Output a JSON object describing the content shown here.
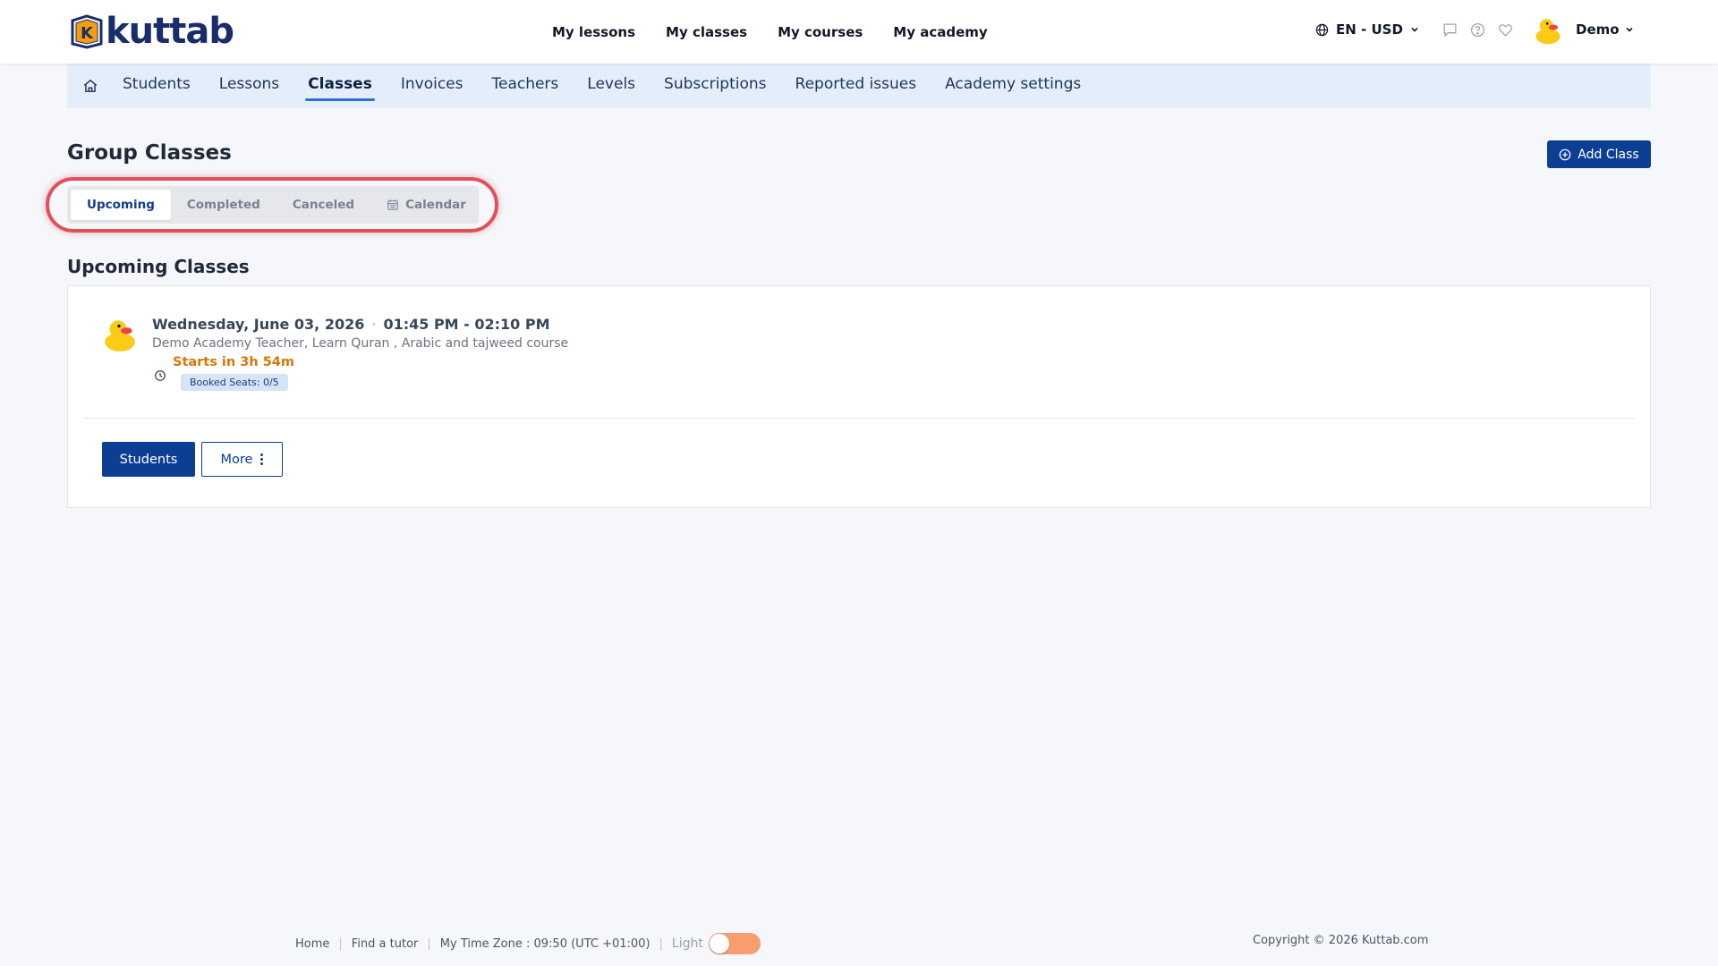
{
  "header": {
    "logo_text": "kuttab",
    "logo_letter": "K",
    "nav": [
      "My lessons",
      "My classes",
      "My courses",
      "My academy"
    ],
    "lang_label": "EN - USD",
    "user_name": "Demo"
  },
  "subnav": {
    "items": [
      "Students",
      "Lessons",
      "Classes",
      "Invoices",
      "Teachers",
      "Levels",
      "Subscriptions",
      "Reported issues",
      "Academy settings"
    ],
    "active": "Classes"
  },
  "page": {
    "title": "Group Classes",
    "add_button": "Add Class"
  },
  "tabs": {
    "upcoming": "Upcoming",
    "completed": "Completed",
    "canceled": "Canceled",
    "calendar": "Calendar",
    "active": "Upcoming"
  },
  "section": {
    "title": "Upcoming Classes"
  },
  "class_card": {
    "date": "Wednesday, June 03, 2026",
    "separator": "·",
    "time": "01:45 PM - 02:10 PM",
    "subtitle": "Demo Academy Teacher, Learn Quran , Arabic and tajweed course",
    "starts_in": "Starts in 3h 54m",
    "booked_seats": "Booked Seats: 0/5",
    "students_button": "Students",
    "more_button": "More"
  },
  "footer": {
    "home": "Home",
    "find_tutor": "Find a tutor",
    "timezone": "My Time Zone : 09:50 (UTC +01:00)",
    "theme_label": "Light",
    "copyright": "Copyright © 2026 Kuttab.com"
  },
  "colors": {
    "primary": "#0c3f94",
    "warning": "#d97706",
    "highlight": "#e0505a",
    "toggle": "#f79d6f",
    "subnav_bg": "#e4eefb"
  }
}
